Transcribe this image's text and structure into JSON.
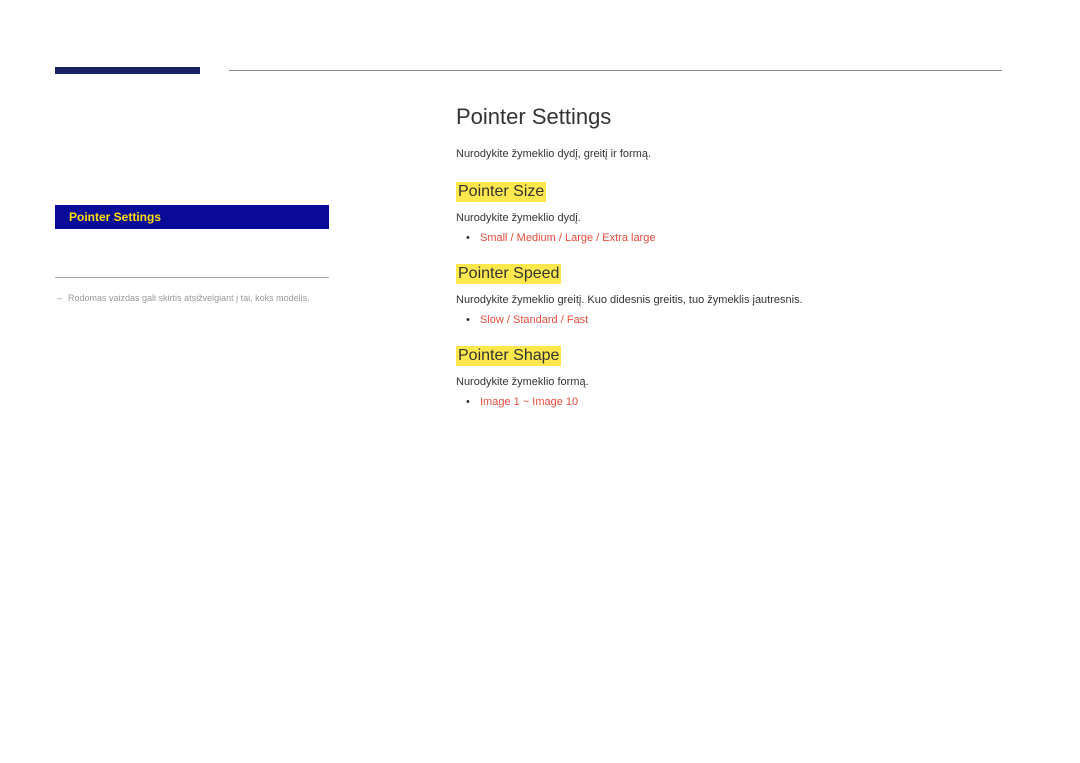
{
  "sidebar": {
    "activeItem": "Pointer Settings",
    "footnote": "Rodomas vaizdas gali skirtis atsižvelgiant į tai, koks modelis."
  },
  "content": {
    "title": "Pointer Settings",
    "intro": "Nurodykite žymeklio dydį, greitį ir formą.",
    "sections": [
      {
        "title": "Pointer Size",
        "desc": "Nurodykite žymeklio dydį.",
        "options": "Small / Medium / Large / Extra large"
      },
      {
        "title": "Pointer Speed",
        "desc": "Nurodykite žymeklio greitį. Kuo didesnis greitis, tuo žymeklis jautresnis.",
        "options": "Slow / Standard / Fast"
      },
      {
        "title": "Pointer Shape",
        "desc": "Nurodykite žymeklio formą.",
        "options": "Image 1 ~ Image 10"
      }
    ]
  }
}
